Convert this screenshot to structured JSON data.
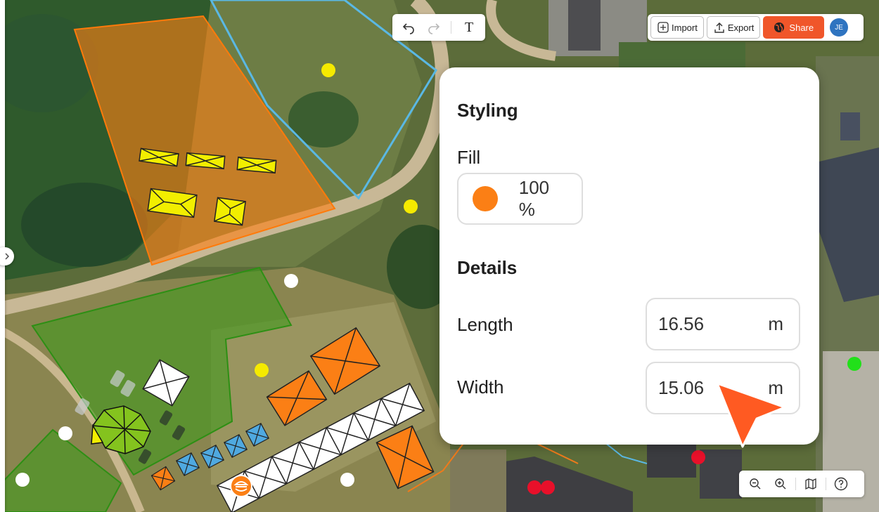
{
  "toolbar": {
    "undo_icon": "undo-icon",
    "redo_icon": "redo-icon",
    "text_tool": "T"
  },
  "actions": {
    "import_label": "Import",
    "export_label": "Export",
    "share_label": "Share",
    "avatar_initials": "JE"
  },
  "panel": {
    "styling_heading": "Styling",
    "fill_label": "Fill",
    "fill_color": "#fb7f15",
    "fill_opacity": "100 %",
    "details_heading": "Details",
    "length_label": "Length",
    "length_value": "16.56",
    "length_unit": "m",
    "width_label": "Width",
    "width_value": "15.06",
    "width_unit": "m"
  },
  "zoom": {
    "zoom_out_icon": "zoom-out-icon",
    "zoom_in_icon": "zoom-in-icon",
    "map_icon": "map-icon",
    "help_icon": "help-icon"
  },
  "colors": {
    "accent": "#f0562a",
    "orange_zone": "#fb7f15",
    "green_zone": "#3f9a1d",
    "blue_outline": "#5ab8e4",
    "tent_yellow": "#f2ee00",
    "tent_white": "#ffffff",
    "tent_blue": "#4fa9e0"
  }
}
